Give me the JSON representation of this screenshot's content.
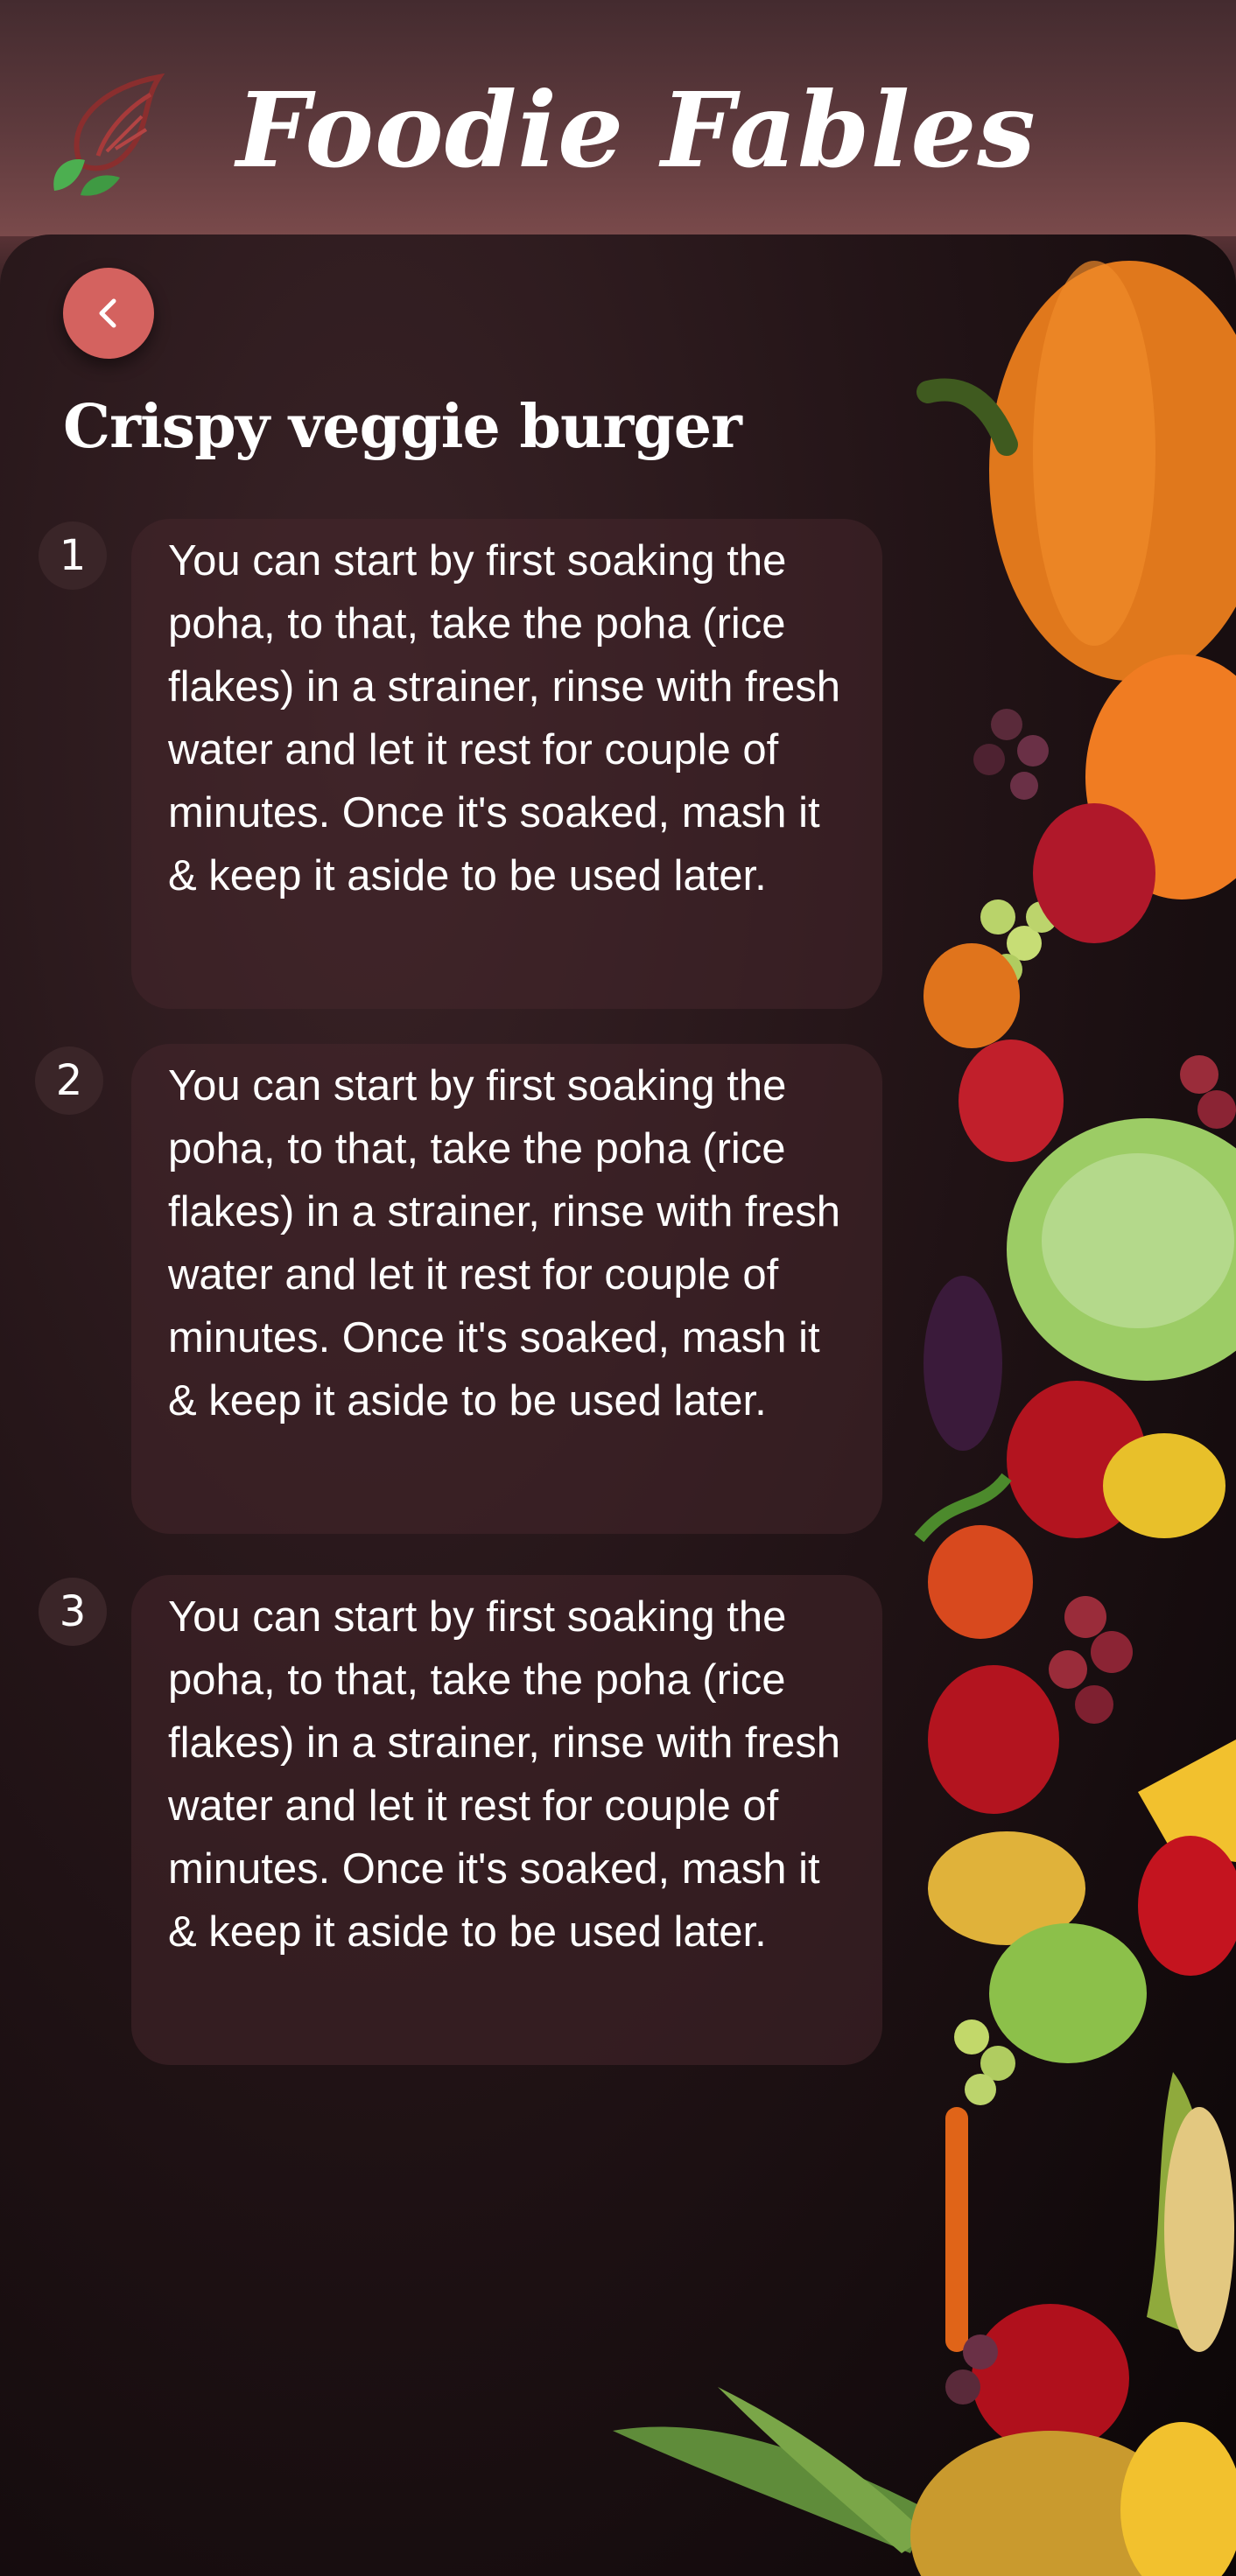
{
  "header": {
    "brand": "Foodie Fables",
    "logo_icon": "chef-leaf-logo-icon"
  },
  "recipe": {
    "title": "Crispy veggie burger",
    "steps": [
      {
        "number": "1",
        "text": "You can start by first soaking the poha, to that, take the poha (rice flakes) in a strainer, rinse with fresh water and let it rest for couple of minutes. Once it's soaked, mash it & keep it aside to be used later."
      },
      {
        "number": "2",
        "text": "You can start by first soaking the poha, to that, take the poha (rice flakes) in a strainer, rinse with fresh water and let it rest for couple of minutes. Once it's soaked, mash it & keep it aside to be used later."
      },
      {
        "number": "3",
        "text": "You can start by first soaking the poha, to that, take the poha (rice flakes) in a strainer, rinse with fresh water and let it rest for couple of minutes. Once it's soaked, mash it & keep it aside to be used later."
      }
    ]
  },
  "nav": {
    "back_icon": "chevron-left-icon"
  },
  "colors": {
    "accent": "#d4625f",
    "header": "#5e3a3d",
    "card": "#46262c"
  }
}
